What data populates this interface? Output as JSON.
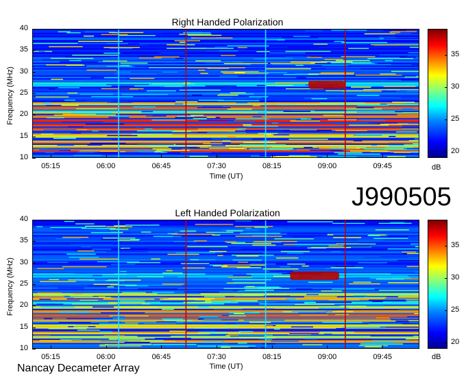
{
  "chart_data": [
    {
      "type": "heatmap",
      "title": "Right Handed Polarization",
      "xlabel": "Time (UT)",
      "ylabel": "Frequency (MHz)",
      "x_ticks": [
        "05:15",
        "06:00",
        "06:45",
        "07:30",
        "08:15",
        "09:00",
        "09:45"
      ],
      "y_ticks": [
        "10",
        "15",
        "20",
        "25",
        "30",
        "35",
        "40"
      ],
      "ylim": [
        10,
        40
      ],
      "colorbar": {
        "unit": "dB",
        "ticks": [
          "20",
          "25",
          "30",
          "35"
        ],
        "range": [
          19,
          39
        ]
      },
      "features": [
        {
          "freq": 11.5,
          "level": 36
        },
        {
          "freq": 12.5,
          "level": 33
        },
        {
          "freq": 13.5,
          "level": 35
        },
        {
          "freq": 15.0,
          "level": 34
        },
        {
          "freq": 16.5,
          "level": 36
        },
        {
          "freq": 17.5,
          "level": 38
        },
        {
          "freq": 18.5,
          "level": 37
        },
        {
          "freq": 19.5,
          "level": 35
        },
        {
          "freq": 20.5,
          "level": 31
        },
        {
          "freq": 21.5,
          "level": 37
        },
        {
          "freq": 22.5,
          "level": 34
        },
        {
          "freq": 27.0,
          "level": 28
        }
      ],
      "burst": {
        "freq_range": [
          26,
          28
        ],
        "time_range": [
          "08:45",
          "09:15"
        ],
        "level": 38
      }
    },
    {
      "type": "heatmap",
      "title": "Left Handed Polarization",
      "xlabel": "Time (UT)",
      "ylabel": "Frequency (MHz)",
      "x_ticks": [
        "05:15",
        "06:00",
        "06:45",
        "07:30",
        "08:15",
        "09:00",
        "09:45"
      ],
      "y_ticks": [
        "10",
        "15",
        "20",
        "25",
        "30",
        "35",
        "40"
      ],
      "ylim": [
        10,
        40
      ],
      "colorbar": {
        "unit": "dB",
        "ticks": [
          "20",
          "25",
          "30",
          "35"
        ],
        "range": [
          19,
          39
        ]
      },
      "features": [
        {
          "freq": 11.5,
          "level": 35
        },
        {
          "freq": 12.5,
          "level": 32
        },
        {
          "freq": 13.5,
          "level": 34
        },
        {
          "freq": 15.0,
          "level": 33
        },
        {
          "freq": 16.5,
          "level": 35
        },
        {
          "freq": 17.5,
          "level": 36
        },
        {
          "freq": 18.5,
          "level": 35
        },
        {
          "freq": 19.5,
          "level": 33
        },
        {
          "freq": 20.5,
          "level": 30
        },
        {
          "freq": 21.5,
          "level": 35
        },
        {
          "freq": 22.5,
          "level": 33
        },
        {
          "freq": 27.0,
          "level": 28
        }
      ],
      "burst": {
        "freq_range": [
          26,
          28
        ],
        "time_range": [
          "08:30",
          "09:10"
        ],
        "level": 38
      }
    }
  ],
  "page": {
    "observation_id": "J990505",
    "instrument": "Nancay Decameter Array"
  },
  "colors": {
    "background_low": "#0022cc",
    "cyan_line": "#20e0ff",
    "red_line": "#c00000"
  }
}
